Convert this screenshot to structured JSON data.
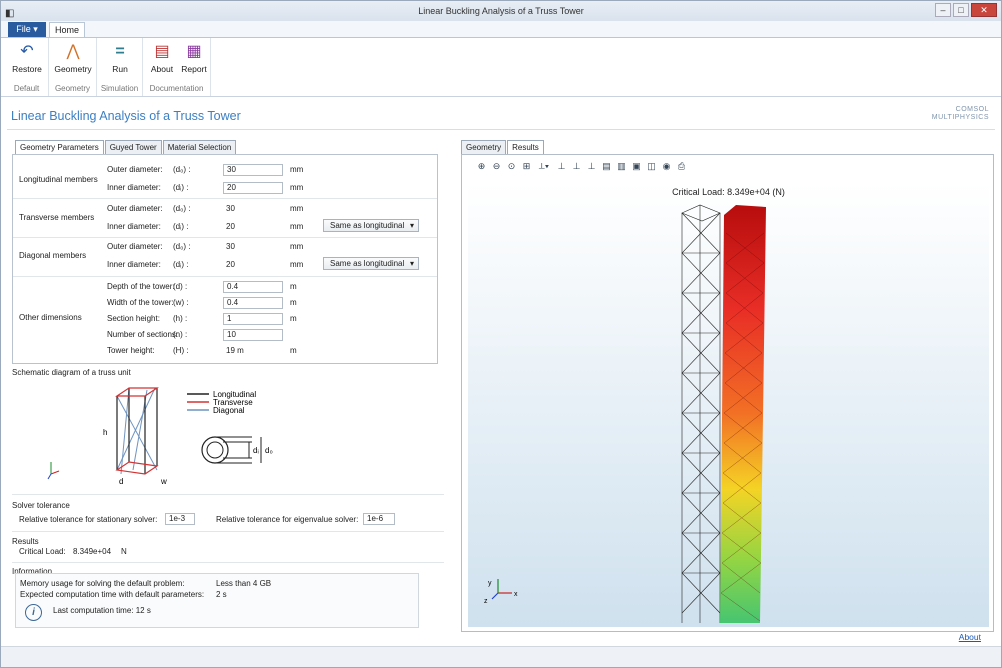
{
  "window": {
    "title": "Linear Buckling Analysis of a Truss Tower"
  },
  "ribbon": {
    "file_label": "File ▾",
    "home_tab": "Home",
    "groups": [
      {
        "label": "Default",
        "buttons": [
          "Restore"
        ]
      },
      {
        "label": "Geometry",
        "buttons": [
          "Geometry"
        ]
      },
      {
        "label": "Simulation",
        "buttons": [
          "Run"
        ]
      },
      {
        "label": "Documentation",
        "buttons": [
          "About",
          "Report"
        ]
      }
    ]
  },
  "app_title": "Linear Buckling Analysis of a  Truss Tower",
  "logo": {
    "line1": "COMSOL",
    "line2": "MULTIPHYSICS"
  },
  "left_tabs": [
    "Geometry Parameters",
    "Guyed Tower",
    "Material Selection"
  ],
  "params": {
    "longitudinal": {
      "title": "Longitudinal members",
      "outer_label": "Outer diameter:",
      "outer_sym": "(d₀) :",
      "outer_val": "30",
      "outer_unit": "mm",
      "inner_label": "Inner diameter:",
      "inner_sym": "(dᵢ) :",
      "inner_val": "20",
      "inner_unit": "mm"
    },
    "transverse": {
      "title": "Transverse members",
      "outer_label": "Outer diameter:",
      "outer_sym": "(d₀) :",
      "outer_val": "30",
      "outer_unit": "mm",
      "inner_label": "Inner diameter:",
      "inner_sym": "(dᵢ) :",
      "inner_val": "20",
      "inner_unit": "mm",
      "select": "Same as longitudinal"
    },
    "diagonal": {
      "title": "Diagonal members",
      "outer_label": "Outer diameter:",
      "outer_sym": "(d₀) :",
      "outer_val": "30",
      "outer_unit": "mm",
      "inner_label": "Inner diameter:",
      "inner_sym": "(dᵢ) :",
      "inner_val": "20",
      "inner_unit": "mm",
      "select": "Same as longitudinal"
    },
    "other": {
      "title": "Other dimensions",
      "depth_label": "Depth of the tower:",
      "depth_sym": "(d) :",
      "depth_val": "0.4",
      "depth_unit": "m",
      "width_label": "Width of the tower:",
      "width_sym": "(w) :",
      "width_val": "0.4",
      "width_unit": "m",
      "section_label": "Section height:",
      "section_sym": "(h) :",
      "section_val": "1",
      "section_unit": "m",
      "num_label": "Number of sections:",
      "num_sym": "(n) :",
      "num_val": "10",
      "height_label": "Tower height:",
      "height_sym": "(H) :",
      "height_val": "19 m",
      "height_unit": "m"
    }
  },
  "schematic": {
    "title": "Schematic diagram of a truss unit",
    "legend": [
      "Longitudinal",
      "Transverse",
      "Diagonal"
    ],
    "legend_colors": [
      "#222222",
      "#d33333",
      "#6f93bf"
    ],
    "h": "h",
    "d": "d",
    "w": "w",
    "di": "dᵢ",
    "do": "d₀"
  },
  "solver": {
    "title": "Solver tolerance",
    "stat_label": "Relative tolerance for stationary solver:",
    "stat_val": "1e-3",
    "eig_label": "Relative tolerance for eigenvalue solver:",
    "eig_val": "1e-6"
  },
  "results": {
    "title": "Results",
    "label": "Critical Load:",
    "value": "8.349e+04",
    "unit": "N"
  },
  "info": {
    "title": "Information",
    "mem_label": "Memory usage for solving the default problem:",
    "mem_val": "Less than 4 GB",
    "time_label": "Expected computation time with default parameters:",
    "time_val": "2 s",
    "last_label": "Last computation time: 12 s"
  },
  "right_tabs": [
    "Geometry",
    "Results"
  ],
  "graphics": {
    "caption": "Critical Load: 8.349e+04 (N)",
    "axes": {
      "x": "x",
      "y": "y",
      "z": "z"
    }
  },
  "footer": {
    "about": "About"
  }
}
